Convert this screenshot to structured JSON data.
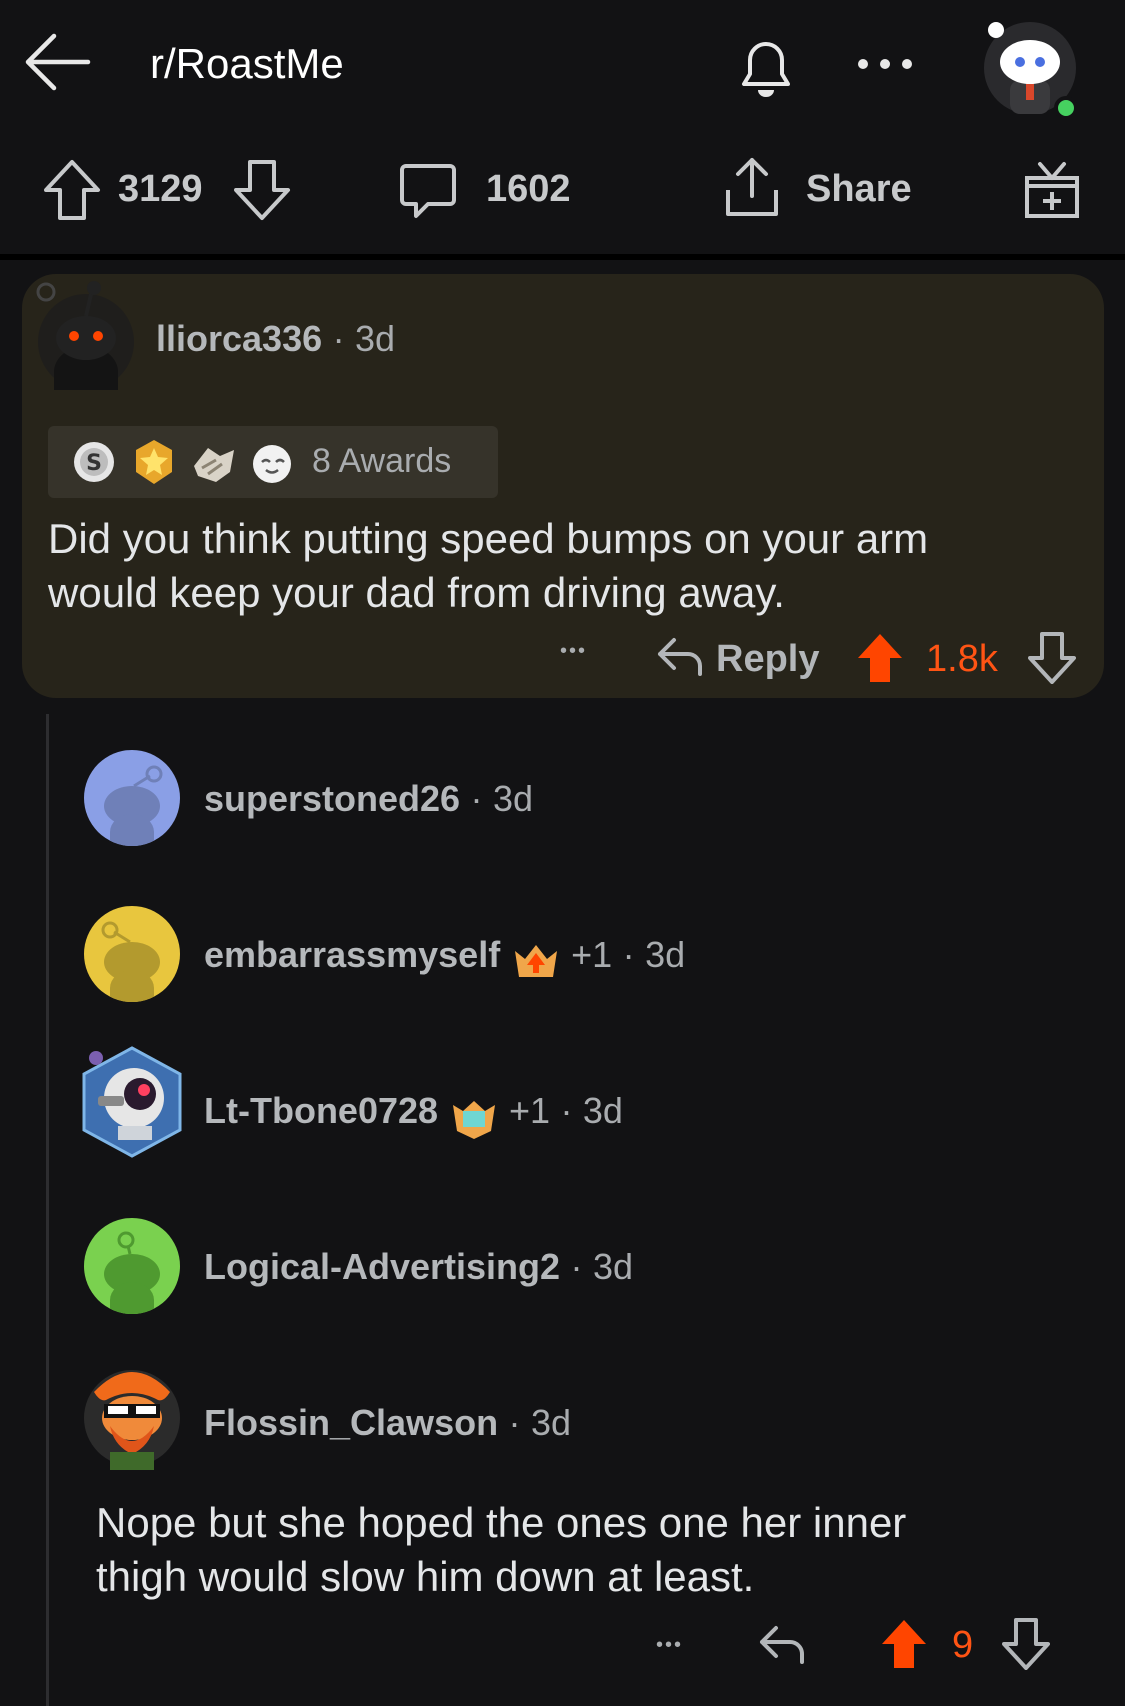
{
  "header": {
    "title": "r/RoastMe",
    "icons": [
      "back-arrow-icon",
      "bell-icon",
      "more-dots-icon",
      "user-avatar"
    ]
  },
  "action_bar": {
    "upvotes": "3129",
    "comments": "1602",
    "share_label": "Share",
    "icons": [
      "upvote-icon",
      "downvote-icon",
      "comment-icon",
      "share-icon",
      "award-icon"
    ]
  },
  "highlight_comment": {
    "username": "lliorca336",
    "sep": "·",
    "time": "3d",
    "awards_label": "8 Awards",
    "body_line1": "Did you think putting speed bumps on your arm",
    "body_line2": "would keep your dad from driving away.",
    "dots": "•••",
    "reply_label": "Reply",
    "score": "1.8k"
  },
  "replies": [
    {
      "username": "superstoned26",
      "sep": "·",
      "time": "3d",
      "avatar_color": "#8a9fe6"
    },
    {
      "username": "embarrassmyself",
      "flair": "+1",
      "sep": "·",
      "time": "3d",
      "avatar_color": "#e8c63e"
    },
    {
      "username": "Lt-Tbone0728",
      "flair": "+1",
      "sep": "·",
      "time": "3d",
      "avatar_color": "#3e6fb0"
    },
    {
      "username": "Logical-Advertising2",
      "sep": "·",
      "time": "3d",
      "avatar_color": "#7ad14f"
    },
    {
      "username": "Flossin_Clawson",
      "sep": "·",
      "time": "3d",
      "avatar_color": "#2b2b2b"
    }
  ],
  "last_comment": {
    "body_line1": "Nope but she hoped the ones one her inner",
    "body_line2": "thigh would slow him down at least.",
    "dots": "•••",
    "score": "9"
  },
  "colors": {
    "background": "#121214",
    "upvote_active": "#ff4500",
    "card_bg": "#27241a",
    "online_dot": "#46d160"
  }
}
